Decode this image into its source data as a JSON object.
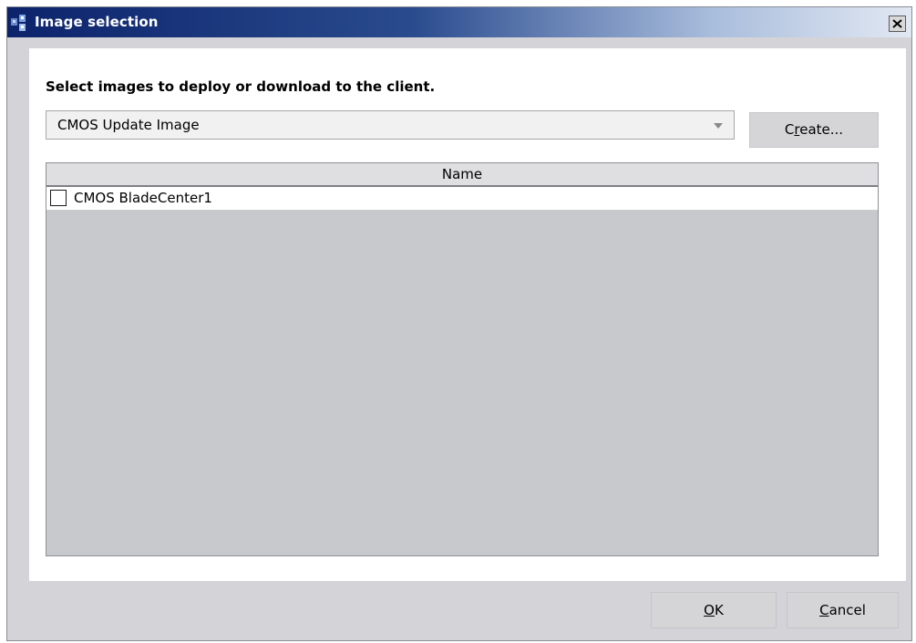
{
  "window": {
    "title": "Image selection"
  },
  "content": {
    "instruction": "Select images to deploy or download to the client.",
    "image_type_dropdown": {
      "selected": "CMOS Update Image"
    },
    "create_button": {
      "pre": "C",
      "mnemonic": "r",
      "post": "eate..."
    },
    "table": {
      "columns": [
        "Name"
      ],
      "rows": [
        {
          "checked": false,
          "name": "CMOS BladeCenter1"
        }
      ]
    }
  },
  "footer": {
    "ok_button": {
      "mnemonic": "O",
      "post": "K"
    },
    "cancel_button": {
      "mnemonic": "C",
      "post": "ancel"
    }
  },
  "icons": {
    "app": "app-icon",
    "close": "close-icon",
    "dropdown": "dropdown-arrow-icon",
    "checkbox": "checkbox-icon"
  },
  "colors": {
    "titlebar_start": "#0c236b",
    "titlebar_end": "#e2e8f3",
    "dialog_background": "#d4d4d8",
    "table_background": "#c8c9cd"
  }
}
